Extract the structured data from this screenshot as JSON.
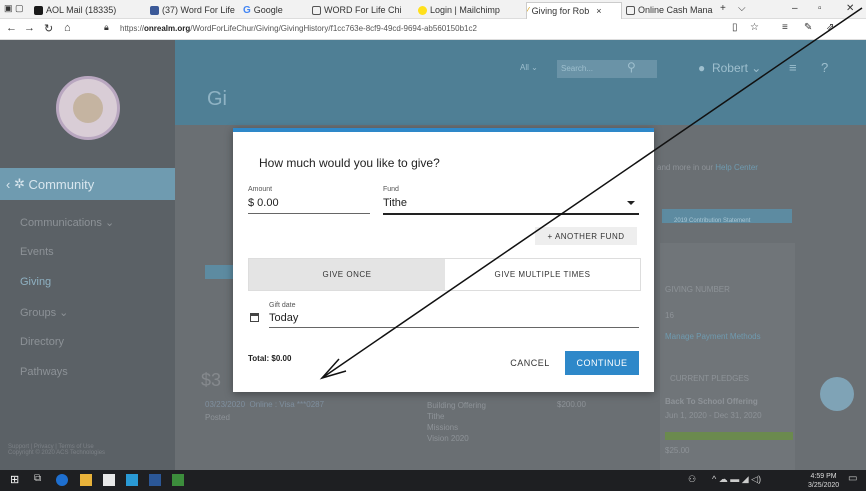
{
  "browser": {
    "tabs": [
      {
        "label": "AOL Mail (18335)",
        "icon": "aol-icon"
      },
      {
        "label": "(37) Word For Life",
        "icon": "facebook-icon"
      },
      {
        "label": "Google",
        "icon": "google-icon"
      },
      {
        "label": "WORD For Life Chi",
        "icon": "page-icon"
      },
      {
        "label": "Login | Mailchimp",
        "icon": "mailchimp-icon"
      },
      {
        "label": "Giving for Rob",
        "icon": "realm-icon",
        "active": true
      },
      {
        "label": "Online Cash Mana",
        "icon": "page-icon"
      }
    ],
    "url_prefix": "https://",
    "url_domain": "onrealm.org",
    "url_path": "/WordForLifeChur/Giving/GivingHistory/f1cc763e-8cf9-49cd-9694-ab560150b1c2"
  },
  "app": {
    "page_title_partial": "Gi",
    "search_scope": "All",
    "search_placeholder": "Search...",
    "user_name": "Robert",
    "sidebar": {
      "section": "Community",
      "items": [
        "Communications",
        "Events",
        "Giving",
        "Groups",
        "Directory",
        "Pathways"
      ],
      "footer_line1": "Support | Privacy | Terms of Use",
      "footer_line2": "Copyright © 2020 ACS Technologies"
    },
    "background": {
      "notice_text": "and more in our",
      "notice_link": "Help Center",
      "contrib_statement": "2019 Contribution Statement",
      "giving_number_label": "GIVING NUMBER",
      "giving_number": "16",
      "payment_methods_link": "Manage Payment Methods",
      "pledges_label": "CURRENT PLEDGES",
      "pledge_name": "Back To School Offering",
      "pledge_dates": "Jun 1, 2020 - Dec 31, 2020",
      "pledge_amount": "$25.00",
      "row_date": "03/23/2020",
      "row_method": "Online : Visa ***0287",
      "row_status": "Posted",
      "row_funds": [
        "Building Offering",
        "Tithe",
        "Missions",
        "Vision 2020"
      ],
      "row_amount": "$200.00",
      "total_partial": "$3"
    }
  },
  "dialog": {
    "title": "How much would you like to give?",
    "amount_label": "Amount",
    "amount_value": "$ 0.00",
    "fund_label": "Fund",
    "fund_value": "Tithe",
    "another_fund": "+ ANOTHER FUND",
    "give_once": "GIVE ONCE",
    "give_multiple": "GIVE MULTIPLE TIMES",
    "gift_date_label": "Gift date",
    "gift_date_value": "Today",
    "total": "Total: $0.00",
    "cancel": "CANCEL",
    "continue": "CONTINUE",
    "accent_color": "#2e88c9"
  },
  "taskbar": {
    "time": "4:59 PM",
    "date": "3/25/2020"
  }
}
